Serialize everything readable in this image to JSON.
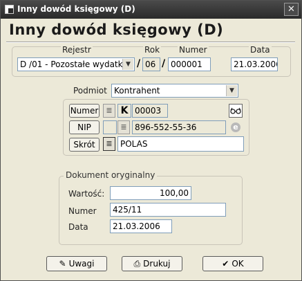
{
  "window": {
    "title": "Inny dowód księgowy (D)",
    "close_glyph": "✕"
  },
  "heading": "Inny dowód księgowy (D)",
  "rejestr": {
    "label_rejestr": "Rejestr",
    "label_rok": "Rok",
    "label_numer": "Numer",
    "label_data": "Data",
    "rejestr_value": "D /01  - Pozostałe wydatk",
    "rok_value": "06",
    "numer_value": "000001",
    "data_value": "21.03.2006",
    "separator": "/"
  },
  "podmiot": {
    "label": "Podmiot",
    "selected": "Kontrahent",
    "numer_btn": "Numer",
    "nip_btn": "NIP",
    "skrot_btn": "Skrót",
    "k_flag": "K",
    "numer_value": "00003",
    "nip_value": "896-552-55-36",
    "skrot_value": "POLAS"
  },
  "dokument": {
    "legend": "Dokument oryginalny",
    "wartosc_label": "Wartość:",
    "wartosc_value": "100,00",
    "numer_label": "Numer",
    "numer_value": "425/11",
    "data_label": "Data",
    "data_value": "21.03.2006"
  },
  "buttons": {
    "uwagi": "Uwagi",
    "drukuj": "Drukuj",
    "ok": "OK"
  },
  "icons": {
    "list": "≣",
    "glasses": "👓",
    "globe": "e",
    "pencil": "✎",
    "printer": "⎙",
    "check": "✔"
  }
}
